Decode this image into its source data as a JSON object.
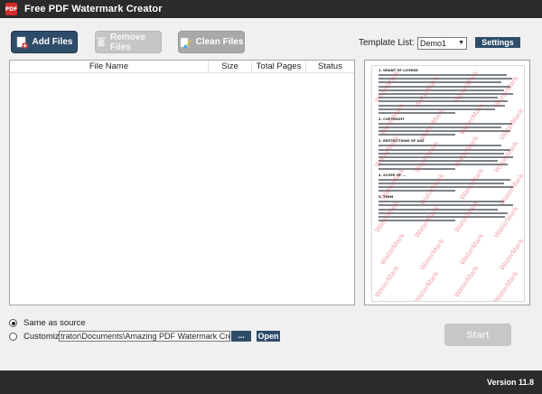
{
  "window": {
    "title": "Free PDF Watermark Creator",
    "icon_text": "PDF"
  },
  "toolbar": {
    "add_label": "Add Files",
    "remove_label": "Remove Files",
    "clean_label": "Clean Files"
  },
  "template": {
    "label": "Template List:",
    "selected": "Demo1",
    "settings_label": "Settings"
  },
  "file_table": {
    "columns": [
      "File Name",
      "Size",
      "Total Pages",
      "Status"
    ],
    "rows": []
  },
  "preview": {
    "watermark_text": "WaterMark",
    "sections": [
      {
        "heading": "1. GRANT OF LICENSE",
        "lines": 11
      },
      {
        "heading": "2. COPYRIGHT",
        "lines": 4
      },
      {
        "heading": "3. RESTRICTIONS OF USE",
        "lines": 7
      },
      {
        "heading": "4. SCOPE OF ...",
        "lines": 4
      },
      {
        "heading": "5. TERM",
        "lines": 6
      }
    ]
  },
  "output": {
    "same_as_source_label": "Same as source",
    "customize_label": "Customize",
    "path_value": "trator\\Documents\\Amazing PDF Watermark Creator\\",
    "browse_label": "...",
    "open_label": "Open",
    "selected": "same_as_source"
  },
  "start_label": "Start",
  "version": "Version 11.8",
  "colors": {
    "title_bar": "#2b2b2b",
    "accent": "#2f4d6a",
    "disabled": "#c7c7c7",
    "watermark": "#dc4650"
  }
}
